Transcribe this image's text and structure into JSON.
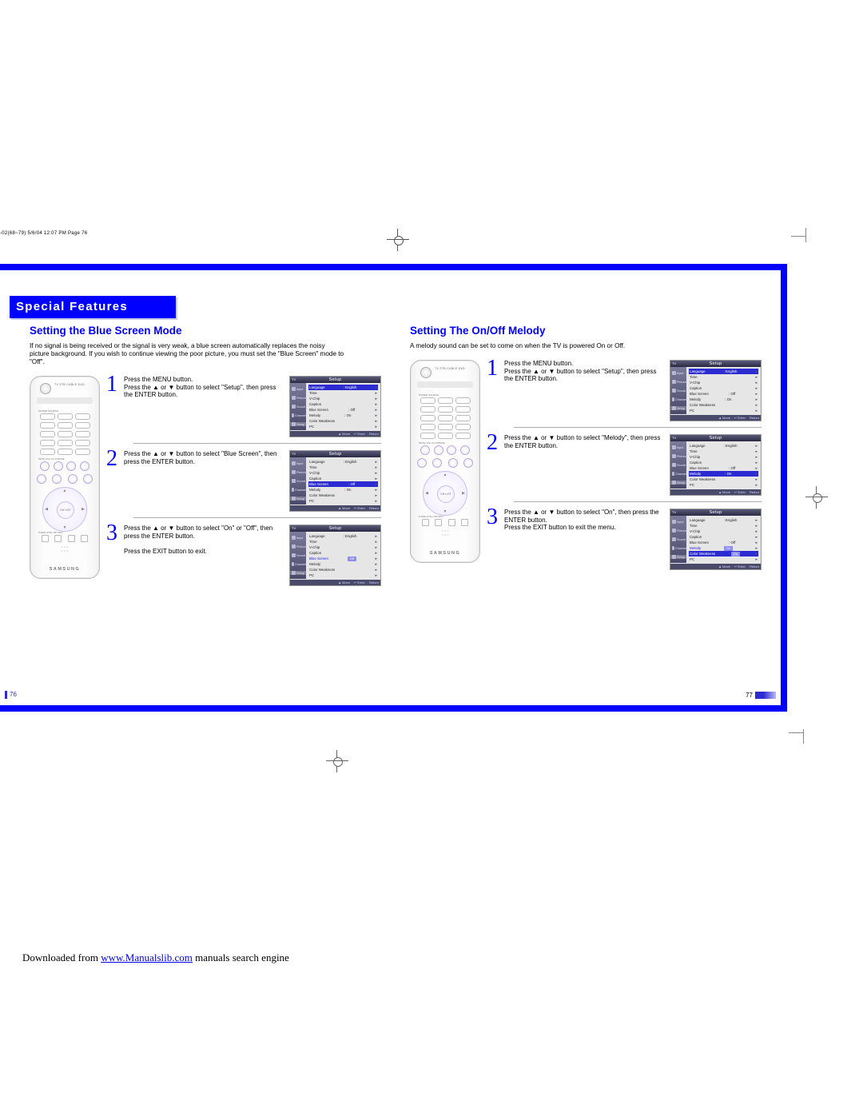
{
  "crop_note": "-02(68~79)  5/6/04  12:07 PM  Page 76",
  "tab_title": "Special Features",
  "left": {
    "heading": "Setting the Blue Screen Mode",
    "intro": "If no signal is being received or the signal is very weak, a blue screen automatically replaces the noisy picture background. If you wish to continue viewing the poor picture, you must set the \"Blue Screen\" mode to \"Off\".",
    "steps": [
      {
        "num": "1",
        "text": "Press the MENU button.\nPress the ▲ or ▼ button to select \"Setup\", then press the ENTER button."
      },
      {
        "num": "2",
        "text": "Press the ▲ or ▼ button to select \"Blue Screen\", then press the ENTER button."
      },
      {
        "num": "3",
        "text": "Press the ▲ or ▼ button to select \"On\" or \"Off\", then press the ENTER button.\n\nPress the EXIT button to exit."
      }
    ],
    "pgnum": "76"
  },
  "right": {
    "heading": "Setting The On/Off Melody",
    "intro": "A melody sound can be set to come on when the TV is powered On or Off.",
    "steps": [
      {
        "num": "1",
        "text": "Press the MENU button.\nPress the ▲ or ▼ button to select \"Setup\", then press the ENTER button."
      },
      {
        "num": "2",
        "text": "Press the ▲ or ▼ button to select \"Melody\", then press the ENTER button."
      },
      {
        "num": "3",
        "text": "Press the ▲ or ▼ button to select \"On\", then press the ENTER button.\nPress the EXIT button to exit the menu."
      }
    ],
    "pgnum": "77"
  },
  "osd": {
    "title": "Setup",
    "tv": "TV",
    "sidebar": [
      "Input",
      "Picture",
      "Sound",
      "Channel",
      "Setup"
    ],
    "rows": {
      "Language": ": English",
      "Time": "",
      "V-Chip": "",
      "Caption": "",
      "Blue Screen": ": Off",
      "Melody": ": On",
      "Color Weakness": "",
      "PC": ""
    },
    "footer": {
      "move": "▲ Move",
      "enter": "↵ Enter",
      "return": "Return"
    },
    "on_box": "On",
    "off_box": "Off"
  },
  "remote": {
    "top_labels": "TV  STB  CABLE  DVD",
    "row_labels1": "POWER         SOURCE",
    "row_labels2": "MUTE   VOL   CH   P.MODE",
    "center": "CH LIST",
    "bottom_labels": "P.SIZE   STILL   PIP   SRS",
    "logo": "SAMSUNG"
  },
  "download": {
    "pre": "Downloaded from ",
    "link": "www.Manualslib.com",
    "post": " manuals search engine"
  }
}
